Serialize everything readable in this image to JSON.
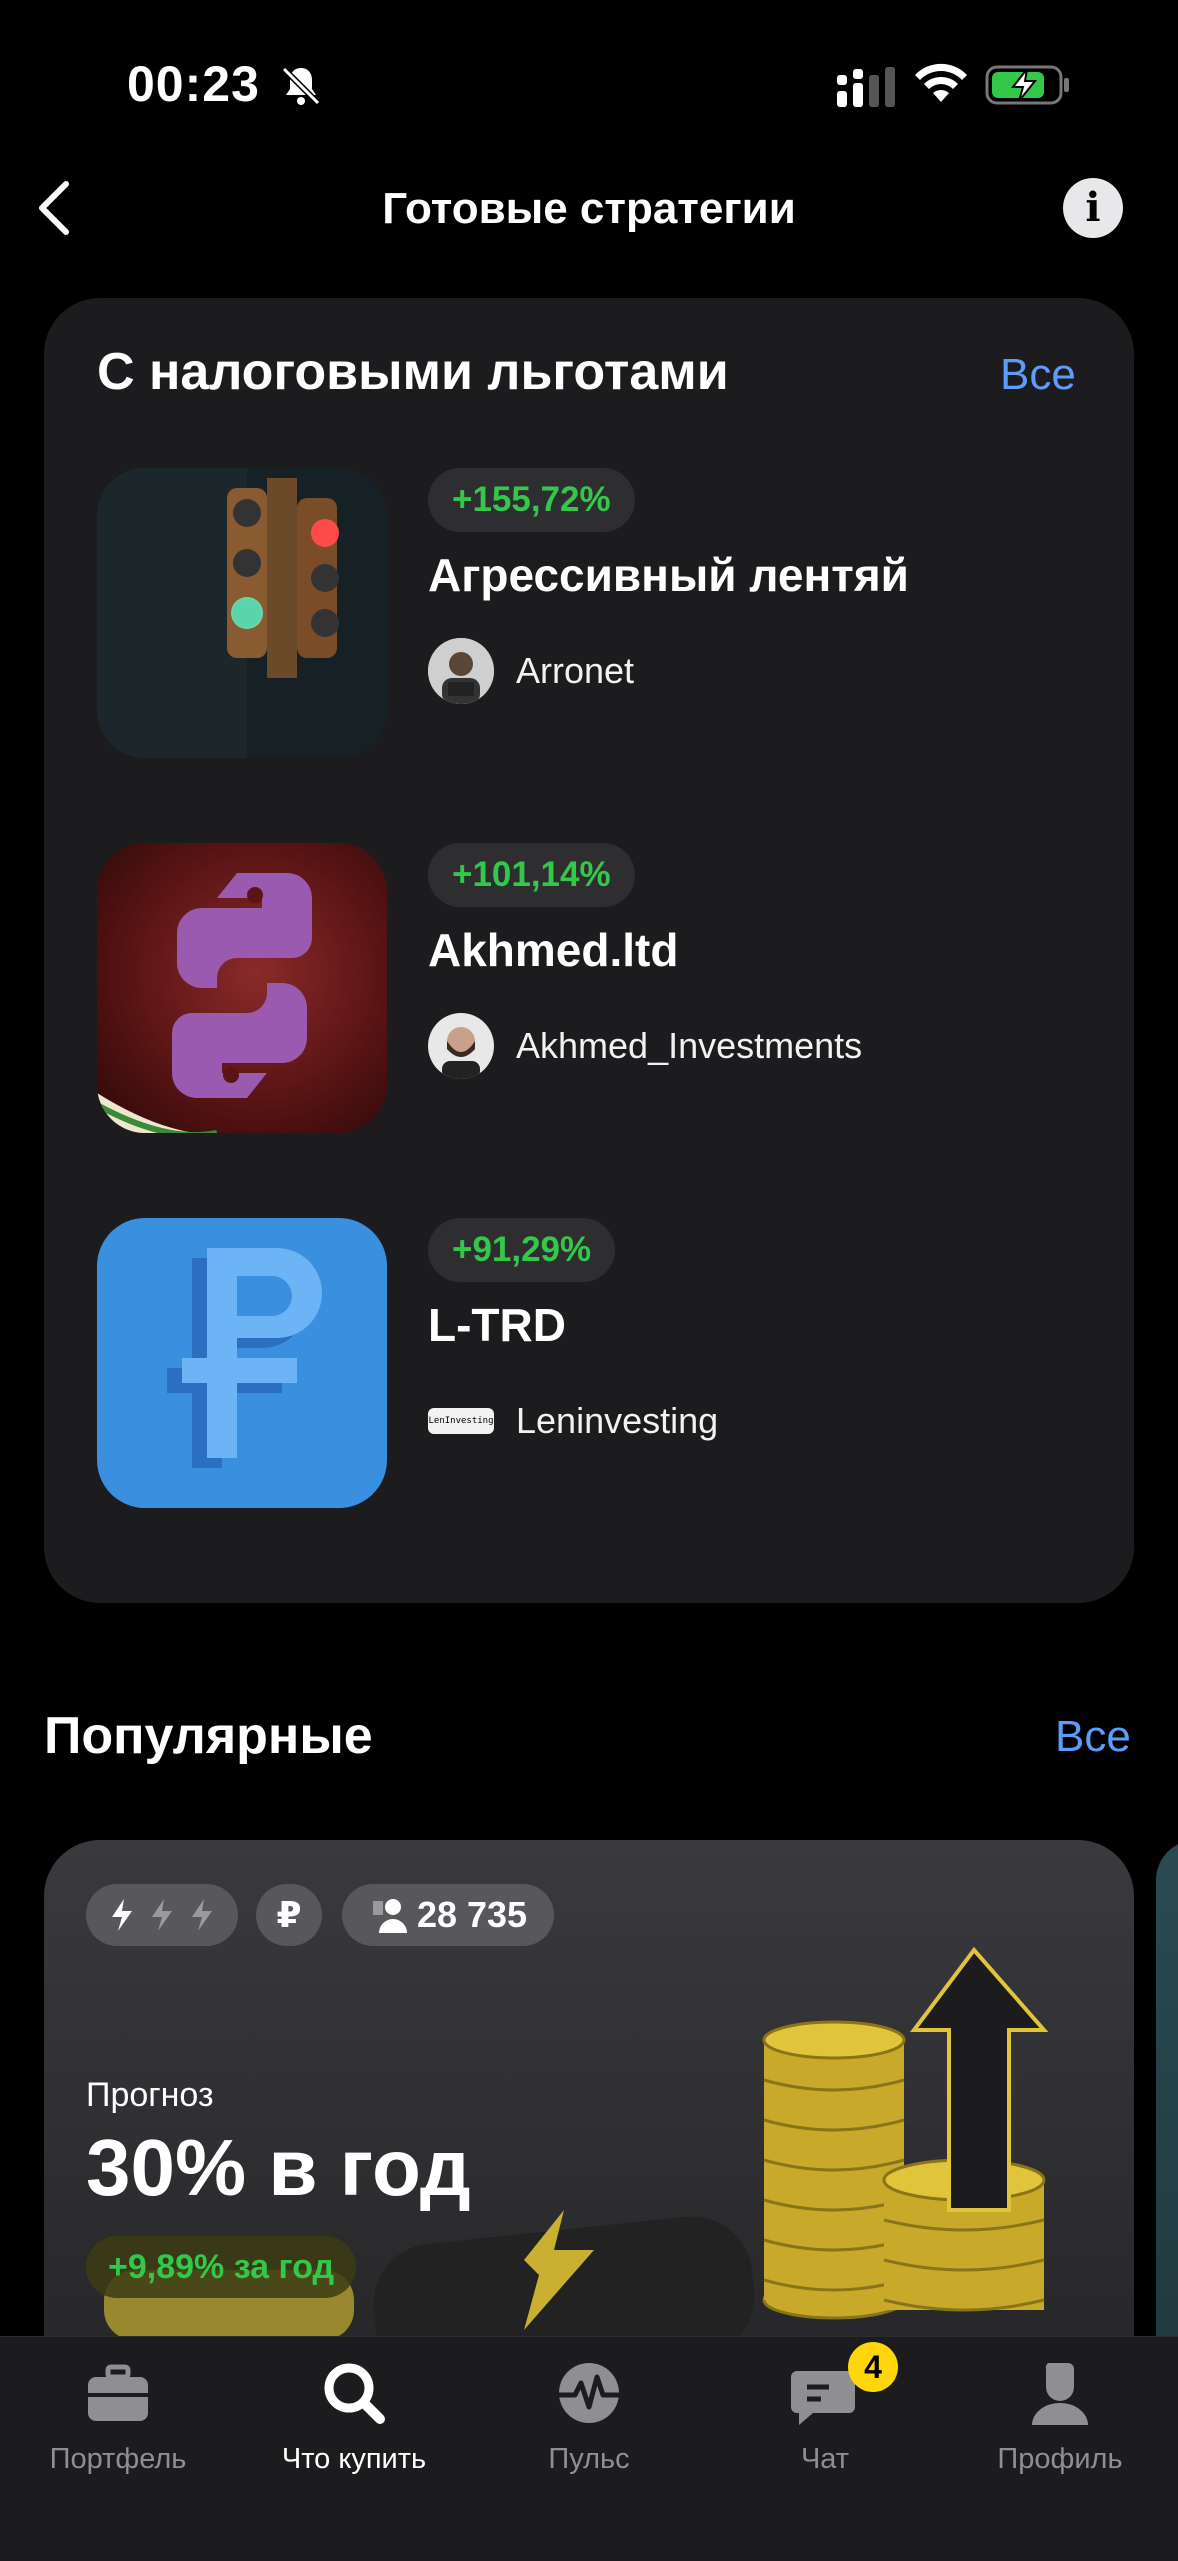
{
  "status_bar": {
    "time": "00:23"
  },
  "nav": {
    "title": "Готовые стратегии"
  },
  "tax_section": {
    "title": "С налоговыми льготами",
    "all_label": "Все",
    "items": [
      {
        "return": "+155,72%",
        "name": "Агрессивный лентяй",
        "author": "Arronet"
      },
      {
        "return": "+101,14%",
        "name": "Akhmed.ltd",
        "author": "Akhmed_Investments"
      },
      {
        "return": "+91,29%",
        "name": "L-TRD",
        "author": "Leninvesting",
        "author_logo_text": "LenInvesting"
      }
    ]
  },
  "popular": {
    "title": "Популярные",
    "all_label": "Все",
    "card": {
      "currency": "₽",
      "subscribers": "28 735",
      "forecast_label": "Прогноз",
      "forecast_value": "30% в год",
      "yield": "+9,89% за год"
    }
  },
  "tabbar": {
    "items": [
      {
        "label": "Портфель",
        "icon": "briefcase-icon"
      },
      {
        "label": "Что купить",
        "icon": "search-icon",
        "active": true
      },
      {
        "label": "Пульс",
        "icon": "pulse-icon"
      },
      {
        "label": "Чат",
        "icon": "chat-icon",
        "badge": "4"
      },
      {
        "label": "Профиль",
        "icon": "profile-icon"
      }
    ]
  },
  "colors": {
    "accent_link": "#5b9dfb",
    "positive": "#34c84a",
    "badge": "#ffd60a"
  }
}
